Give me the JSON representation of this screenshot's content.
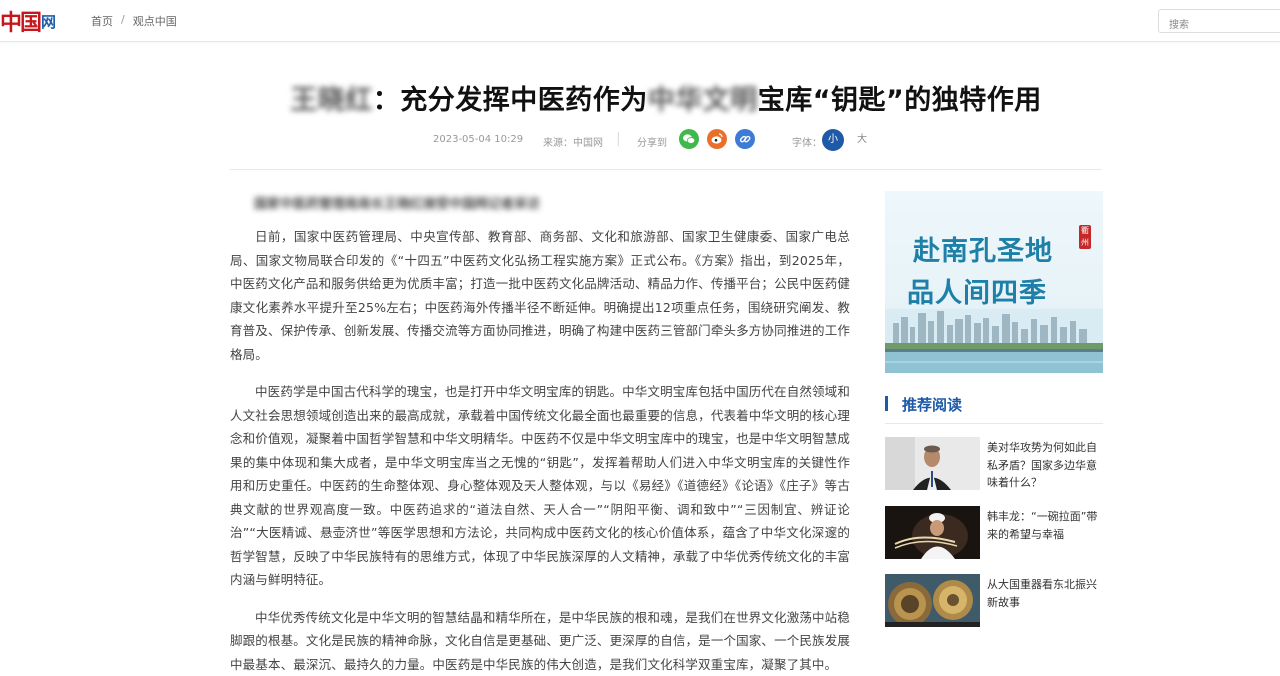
{
  "header": {
    "logo_main": "中国",
    "logo_suffix": "网",
    "breadcrumb": [
      "首页",
      "观点中国"
    ],
    "breadcrumb_sep": "/",
    "search_placeholder": "搜索"
  },
  "article": {
    "title_blurred_prefix": "王晓红",
    "title_middle": "：充分发挥中医药作为",
    "title_blurred_mid": "中华文明",
    "title_end": "宝库“钥匙”的独特作用",
    "date": "2023-05-04 10:29",
    "source_label": "来源：",
    "source": "中国网",
    "share_label": "分享到",
    "font_label": "字体：",
    "font_small": "小",
    "font_large": "大",
    "subtitle_blurred": "国家中医药管理局局长王晓红接受中国网记者采访",
    "paragraphs": [
      "日前，国家中医药管理局、中央宣传部、教育部、商务部、文化和旅游部、国家卫生健康委、国家广电总局、国家文物局联合印发的《“十四五”中医药文化弘扬工程实施方案》正式公布。《方案》指出，到2025年，中医药文化产品和服务供给更为优质丰富；打造一批中医药文化品牌活动、精品力作、传播平台；公民中医药健康文化素养水平提升至25%左右；中医药海外传播半径不断延伸。明确提出12项重点任务，围绕研究阐发、教育普及、保护传承、创新发展、传播交流等方面协同推进，明确了构建中医药三管部门牵头多方协同推进的工作格局。",
      "中医药学是中国古代科学的瑰宝，也是打开中华文明宝库的钥匙。中华文明宝库包括中国历代在自然领域和人文社会思想领域创造出来的最高成就，承载着中国传统文化最全面也最重要的信息，代表着中华文明的核心理念和价值观，凝聚着中国哲学智慧和中华文明精华。中医药不仅是中华文明宝库中的瑰宝，也是中华文明智慧成果的集中体现和集大成者，是中华文明宝库当之无愧的“钥匙”，发挥着帮助人们进入中华文明宝库的关键性作用和历史重任。中医药的生命整体观、身心整体观及天人整体观，与以《易经》《道德经》《论语》《庄子》等古典文献的世界观高度一致。中医药追求的“道法自然、天人合一”“阴阳平衡、调和致中”“三因制宜、辨证论治”“大医精诚、悬壶济世”等医学思想和方法论，共同构成中医药文化的核心价值体系，蕴含了中华文化深邃的哲学智慧，反映了中华民族特有的思维方式，体现了中华民族深厚的人文精神，承载了中华优秀传统文化的丰富内涵与鲜明特征。",
      "中华优秀传统文化是中华文明的智慧结晶和精华所在，是中华民族的根和魂，是我们在世界文化激荡中站稳脚跟的根基。文化是民族的精神命脉，文化自信是更基础、更广泛、更深厚的自信，是一个国家、一个民族发展中最基本、最深沉、最持久的力量。中医药是中华民族的伟大创造，是我们文化科学双重宝库，凝聚了其中。"
    ]
  },
  "sidebar": {
    "banner_line1": "赴南孔圣地",
    "banner_line2": "品人间四季",
    "banner_seal": "衢州",
    "rec_title": "推荐阅读",
    "items": [
      {
        "title": "美对华攻势为何如此自私矛盾？国家多边华意味着什么？"
      },
      {
        "title": "韩丰龙：“一碗拉面”带来的希望与幸福"
      },
      {
        "title": "从大国重器看东北振兴新故事"
      }
    ]
  },
  "colors": {
    "accent_blue": "#1e5aa8",
    "logo_red": "#c8161d",
    "wechat_green": "#3fb94b",
    "weibo_orange": "#e8702a",
    "link_blue": "#3d7bd6"
  }
}
